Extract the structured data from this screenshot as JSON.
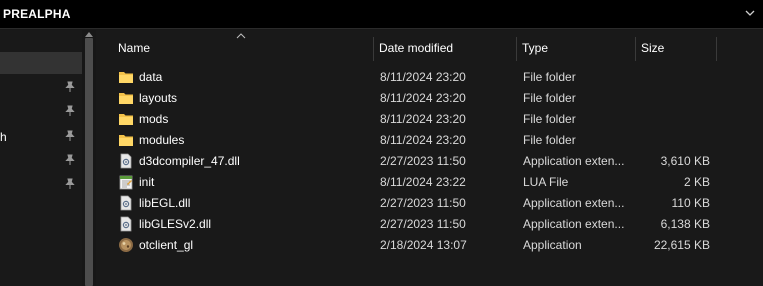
{
  "window": {
    "title": "PREALPHA"
  },
  "nav": {
    "items": [
      {
        "label": "",
        "pinned": true
      },
      {
        "label": "",
        "pinned": true
      },
      {
        "label": "h",
        "pinned": true
      },
      {
        "label": "",
        "pinned": true
      },
      {
        "label": "",
        "pinned": true
      }
    ]
  },
  "columns": {
    "name": "Name",
    "date_modified": "Date modified",
    "type": "Type",
    "size": "Size"
  },
  "files": [
    {
      "name": "data",
      "date": "8/11/2024 23:20",
      "type": "File folder",
      "size": "",
      "icon": "folder-icon"
    },
    {
      "name": "layouts",
      "date": "8/11/2024 23:20",
      "type": "File folder",
      "size": "",
      "icon": "folder-icon"
    },
    {
      "name": "mods",
      "date": "8/11/2024 23:20",
      "type": "File folder",
      "size": "",
      "icon": "folder-icon"
    },
    {
      "name": "modules",
      "date": "8/11/2024 23:20",
      "type": "File folder",
      "size": "",
      "icon": "folder-icon"
    },
    {
      "name": "d3dcompiler_47.dll",
      "date": "2/27/2023 11:50",
      "type": "Application exten...",
      "size": "3,610 KB",
      "icon": "dll-file-icon"
    },
    {
      "name": "init",
      "date": "8/11/2024 23:22",
      "type": "LUA File",
      "size": "2 KB",
      "icon": "lua-file-icon"
    },
    {
      "name": "libEGL.dll",
      "date": "2/27/2023 11:50",
      "type": "Application exten...",
      "size": "110 KB",
      "icon": "dll-file-icon"
    },
    {
      "name": "libGLESv2.dll",
      "date": "2/27/2023 11:50",
      "type": "Application exten...",
      "size": "6,138 KB",
      "icon": "dll-file-icon"
    },
    {
      "name": "otclient_gl",
      "date": "2/18/2024 13:07",
      "type": "Application",
      "size": "22,615 KB",
      "icon": "app-icon"
    }
  ],
  "colors": {
    "background": "#191919",
    "folder": "#f3c24a",
    "text": "#ffffff"
  }
}
